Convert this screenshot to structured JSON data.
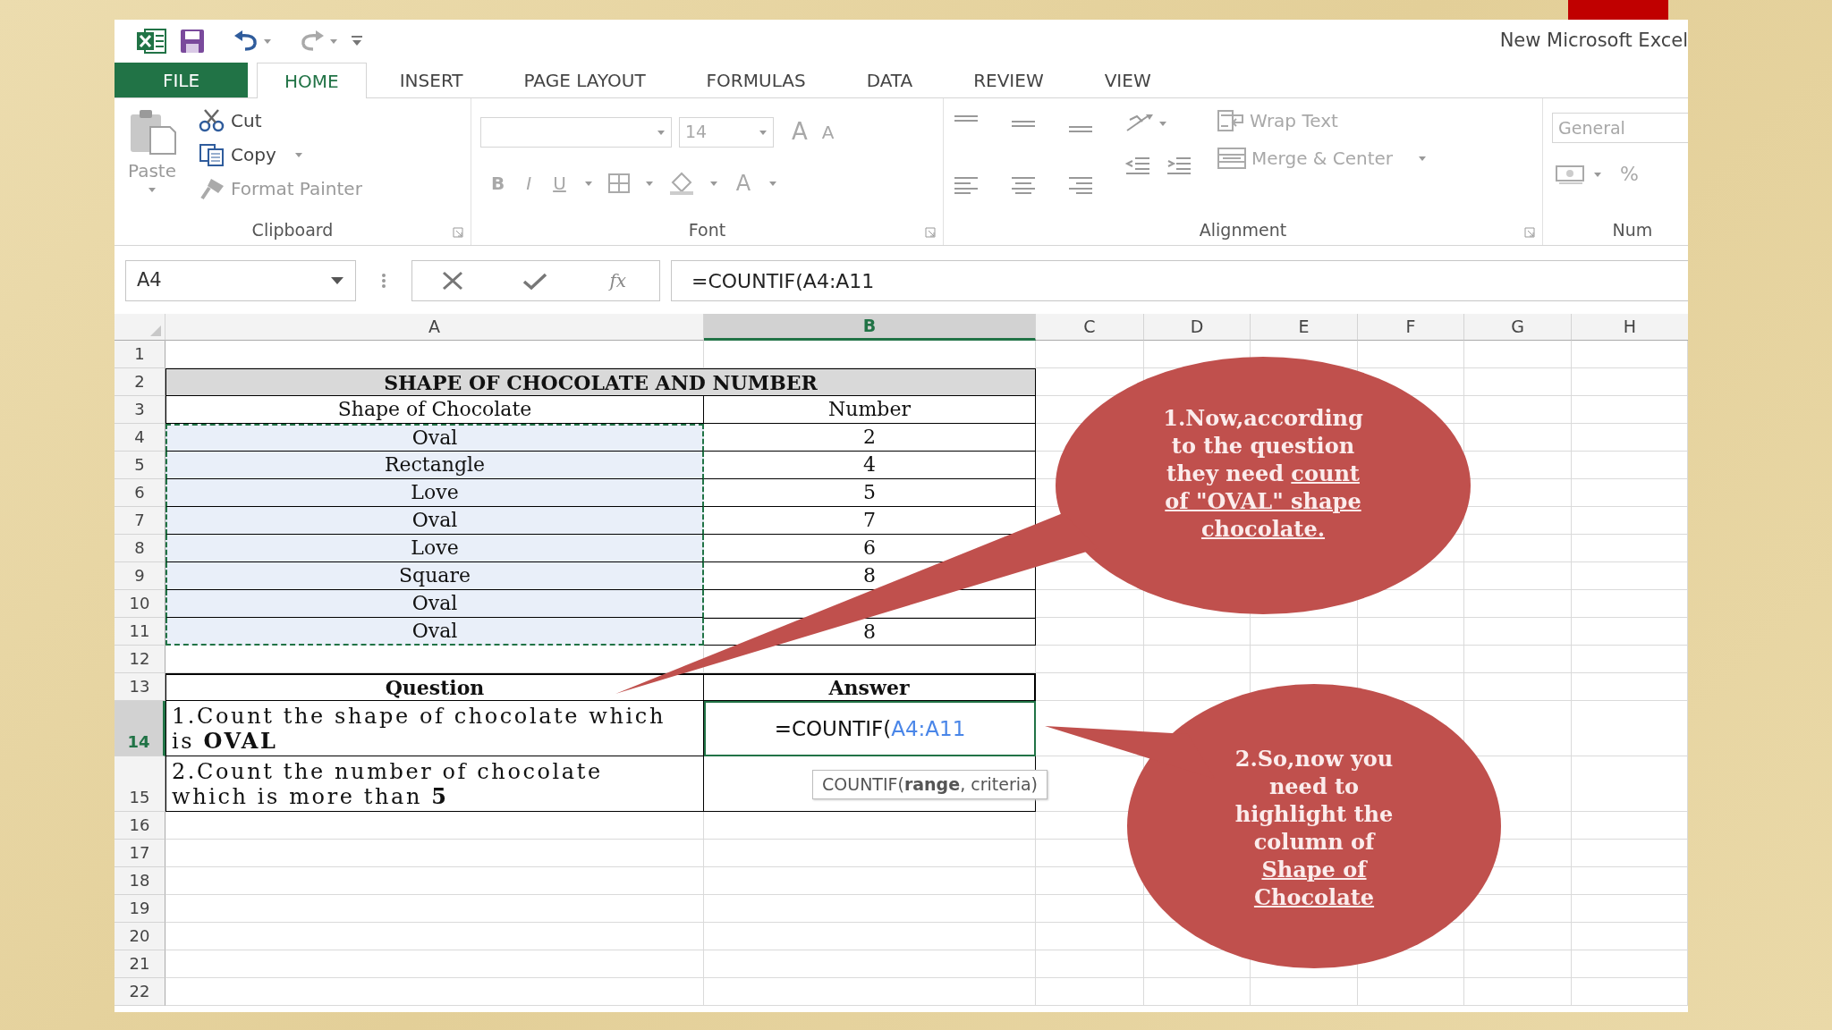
{
  "window": {
    "title": "New Microsoft Excel"
  },
  "ribbon_tabs": [
    {
      "label": "FILE",
      "kind": "file",
      "selected": false
    },
    {
      "label": "HOME",
      "kind": "tab",
      "selected": true
    },
    {
      "label": "INSERT",
      "kind": "tab",
      "selected": false
    },
    {
      "label": "PAGE LAYOUT",
      "kind": "tab",
      "selected": false
    },
    {
      "label": "FORMULAS",
      "kind": "tab",
      "selected": false
    },
    {
      "label": "DATA",
      "kind": "tab",
      "selected": false
    },
    {
      "label": "REVIEW",
      "kind": "tab",
      "selected": false
    },
    {
      "label": "VIEW",
      "kind": "tab",
      "selected": false
    }
  ],
  "clipboard": {
    "group": "Clipboard",
    "paste": {
      "label": "Paste",
      "disabled": true
    },
    "items": [
      {
        "kind": "cut",
        "label": "Cut",
        "disabled": false
      },
      {
        "kind": "copy",
        "label": "Copy",
        "disabled": false
      },
      {
        "kind": "painter",
        "label": "Format Painter",
        "disabled": true
      }
    ]
  },
  "font": {
    "group": "Font",
    "size": "14",
    "grow": "A",
    "shrink": "A",
    "bold": "B",
    "italic": "I",
    "underline": "U",
    "font_color": "A"
  },
  "alignment": {
    "group": "Alignment",
    "wrap_text": "Wrap Text",
    "merge": "Merge & Center"
  },
  "number": {
    "group": "Num",
    "format": "General",
    "percent": "%"
  },
  "formula_bar": {
    "name_box": "A4",
    "insert_function": "fx",
    "formula": "=COUNTIF(A4:A11"
  },
  "columns": [
    {
      "label": "A",
      "selected": false
    },
    {
      "label": "B",
      "selected": true
    },
    {
      "label": "C",
      "selected": false
    },
    {
      "label": "D",
      "selected": false
    },
    {
      "label": "E",
      "selected": false
    },
    {
      "label": "F",
      "selected": false
    },
    {
      "label": "G",
      "selected": false
    },
    {
      "label": "H",
      "selected": false
    }
  ],
  "row_headers": [
    {
      "label": "1",
      "selected": false
    },
    {
      "label": "2",
      "selected": false
    },
    {
      "label": "3",
      "selected": false
    },
    {
      "label": "4",
      "selected": false
    },
    {
      "label": "5",
      "selected": false
    },
    {
      "label": "6",
      "selected": false
    },
    {
      "label": "7",
      "selected": false
    },
    {
      "label": "8",
      "selected": false
    },
    {
      "label": "9",
      "selected": false
    },
    {
      "label": "10",
      "selected": false
    },
    {
      "label": "11",
      "selected": false
    },
    {
      "label": "12",
      "selected": false
    },
    {
      "label": "13",
      "selected": false
    },
    {
      "label": "14",
      "selected": true
    },
    {
      "label": "15",
      "selected": false
    },
    {
      "label": "16",
      "selected": false
    },
    {
      "label": "17",
      "selected": false
    },
    {
      "label": "18",
      "selected": false
    },
    {
      "label": "19",
      "selected": false
    },
    {
      "label": "20",
      "selected": false
    },
    {
      "label": "21",
      "selected": false
    },
    {
      "label": "22",
      "selected": false
    }
  ],
  "data_table": {
    "title": "SHAPE OF CHOCOLATE AND NUMBER",
    "headers": [
      "Shape of Chocolate",
      "Number"
    ],
    "rows": [
      {
        "shape": "Oval",
        "number": "2",
        "in_range": true
      },
      {
        "shape": "Rectangle",
        "number": "4",
        "in_range": true
      },
      {
        "shape": "Love",
        "number": "5",
        "in_range": true
      },
      {
        "shape": "Oval",
        "number": "7",
        "in_range": true
      },
      {
        "shape": "Love",
        "number": "6",
        "in_range": true
      },
      {
        "shape": "Square",
        "number": "8",
        "in_range": true
      },
      {
        "shape": "Oval",
        "in_range": true
      },
      {
        "shape": "Oval",
        "number": "8",
        "in_range": true
      }
    ]
  },
  "question_table": {
    "headers": [
      "Question",
      "Answer"
    ],
    "rows": [
      {
        "question": "1.Count the shape of chocolate which is **OVAL**",
        "answer": {
          "text": "=COUNTIF(",
          "ref": "A4:A11"
        },
        "active": true
      },
      {
        "question": "2.Count the number of chocolate which is more than **5**",
        "active": false
      }
    ]
  },
  "tooltip": "COUNTIF(**range**, criteria)",
  "callouts": [
    {
      "text": "1.Now,according\nto the question\nthey need",
      "underlined": "count\nof \"OVAL\" shape\nchocolate."
    },
    {
      "text": "2.So,now you\nneed to\nhighlight the\ncolumn of\n",
      "underlined": "Shape of\nChocolate"
    }
  ]
}
